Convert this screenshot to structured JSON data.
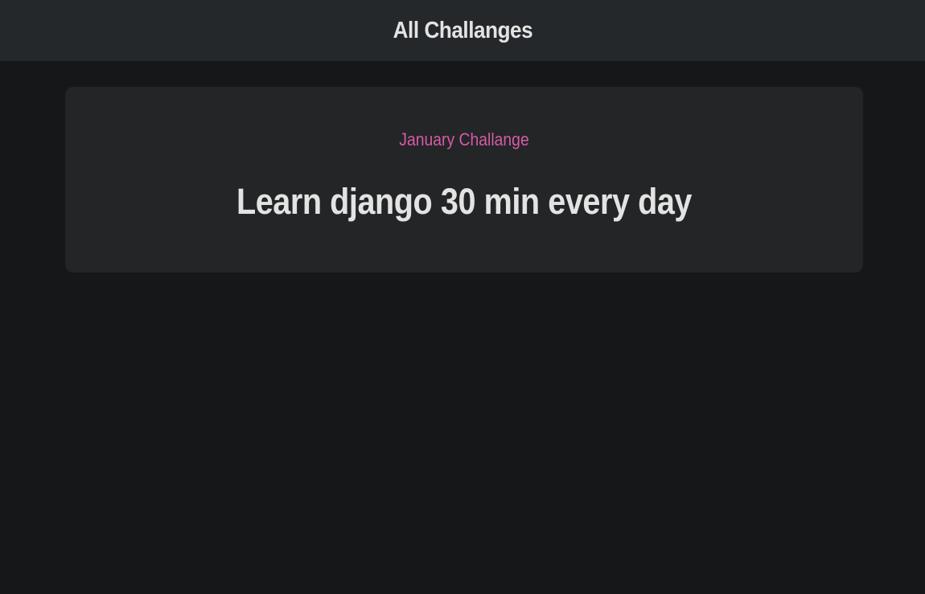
{
  "header": {
    "title": "All Challanges"
  },
  "challenge": {
    "month_label": "January Challange",
    "text": "Learn django 30 min every day"
  },
  "colors": {
    "page_background": "#161719",
    "header_background": "#25282b",
    "card_background": "#232527",
    "text_primary": "#e3e3e3",
    "accent_pink": "#d65aa6"
  }
}
